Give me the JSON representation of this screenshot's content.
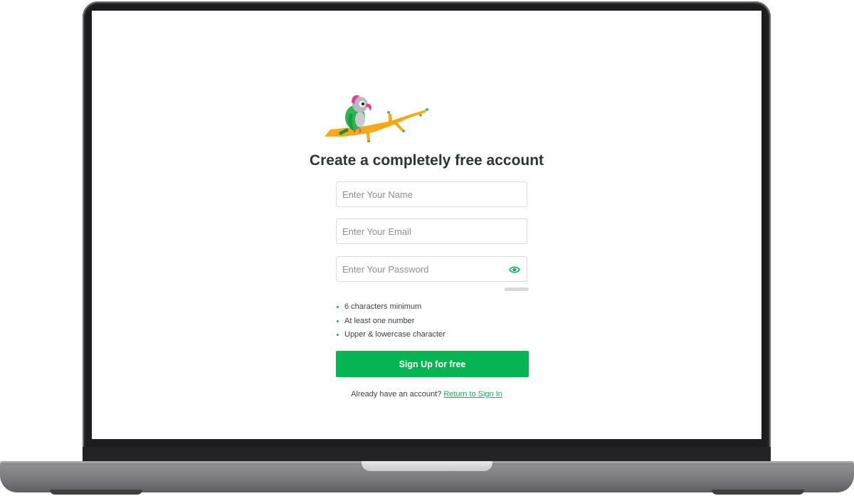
{
  "page": {
    "title": "Create a completely free account"
  },
  "form": {
    "name_placeholder": "Enter Your Name",
    "email_placeholder": "Enter Your Email",
    "password_placeholder": "Enter Your Password",
    "password_toggle_icon": "eye-icon",
    "password_strength": 0,
    "rules": [
      {
        "label": "6 characters minimum"
      },
      {
        "label": "At least one number"
      },
      {
        "label": "Upper & lowercase character"
      }
    ],
    "submit_label": "Sign Up for free"
  },
  "footer": {
    "prompt": "Already have an account?",
    "link_label": "Return to Sign In"
  },
  "colors": {
    "accent": "#06b454",
    "title": "#2d3436",
    "laptop_frame": "#1d1d1f"
  }
}
